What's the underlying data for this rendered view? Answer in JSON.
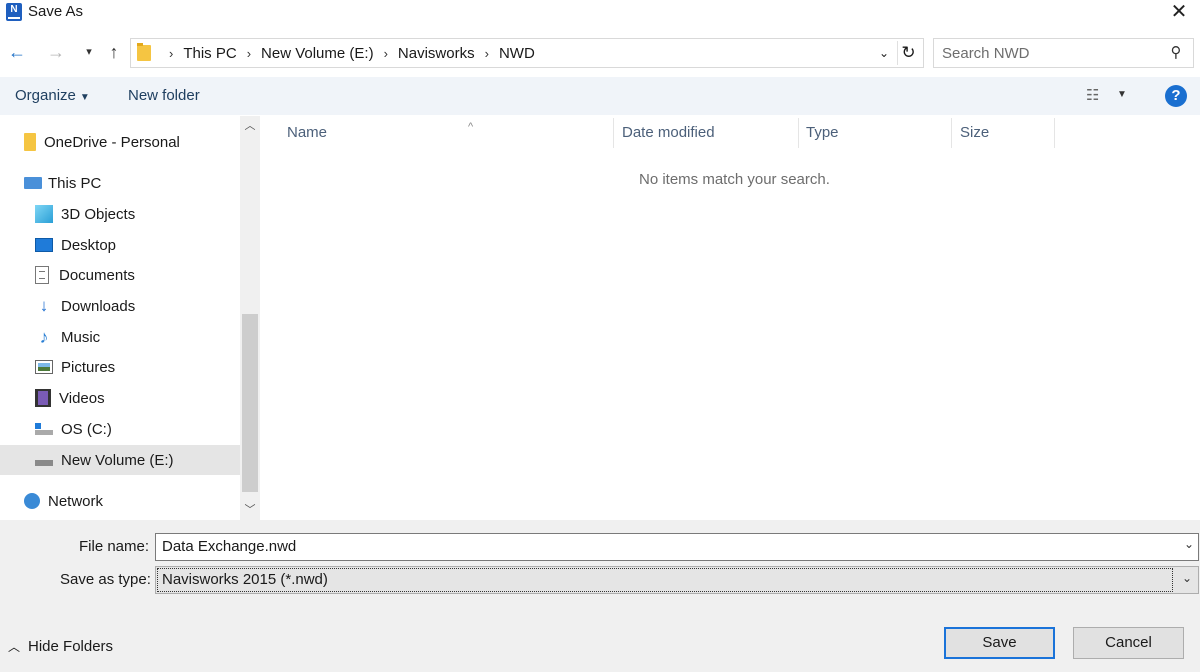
{
  "window": {
    "title": "Save As",
    "app_icon_letter": "N"
  },
  "nav": {
    "breadcrumbs": [
      "This PC",
      "New Volume (E:)",
      "Navisworks",
      "NWD"
    ],
    "search_placeholder": "Search NWD"
  },
  "toolbar": {
    "organize_label": "Organize",
    "new_folder_label": "New folder",
    "help_label": "?"
  },
  "sidebar": {
    "items": [
      {
        "label": "OneDrive - Personal",
        "icon": "onedrive-folder-icon"
      },
      {
        "label": "This PC",
        "icon": "pc-icon"
      },
      {
        "label": "3D Objects",
        "icon": "3d-objects-icon"
      },
      {
        "label": "Desktop",
        "icon": "desktop-icon"
      },
      {
        "label": "Documents",
        "icon": "documents-icon"
      },
      {
        "label": "Downloads",
        "icon": "downloads-icon"
      },
      {
        "label": "Music",
        "icon": "music-icon"
      },
      {
        "label": "Pictures",
        "icon": "pictures-icon"
      },
      {
        "label": "Videos",
        "icon": "videos-icon"
      },
      {
        "label": "OS (C:)",
        "icon": "drive-c-icon"
      },
      {
        "label": "New Volume (E:)",
        "icon": "drive-icon",
        "selected": true
      },
      {
        "label": "Network",
        "icon": "network-icon"
      }
    ]
  },
  "list": {
    "columns": [
      "Name",
      "Date modified",
      "Type",
      "Size"
    ],
    "empty_message": "No items match your search."
  },
  "form": {
    "file_name_label": "File name:",
    "file_name_value": "Data Exchange.nwd",
    "save_type_label": "Save as type:",
    "save_type_value": "Navisworks 2015 (*.nwd)"
  },
  "footer": {
    "hide_folders_label": "Hide Folders",
    "save_label": "Save",
    "cancel_label": "Cancel"
  },
  "colors": {
    "accent": "#1a73d9",
    "toolbar_bg": "#f0f4f9",
    "selected_bg": "#e5e5e5"
  }
}
